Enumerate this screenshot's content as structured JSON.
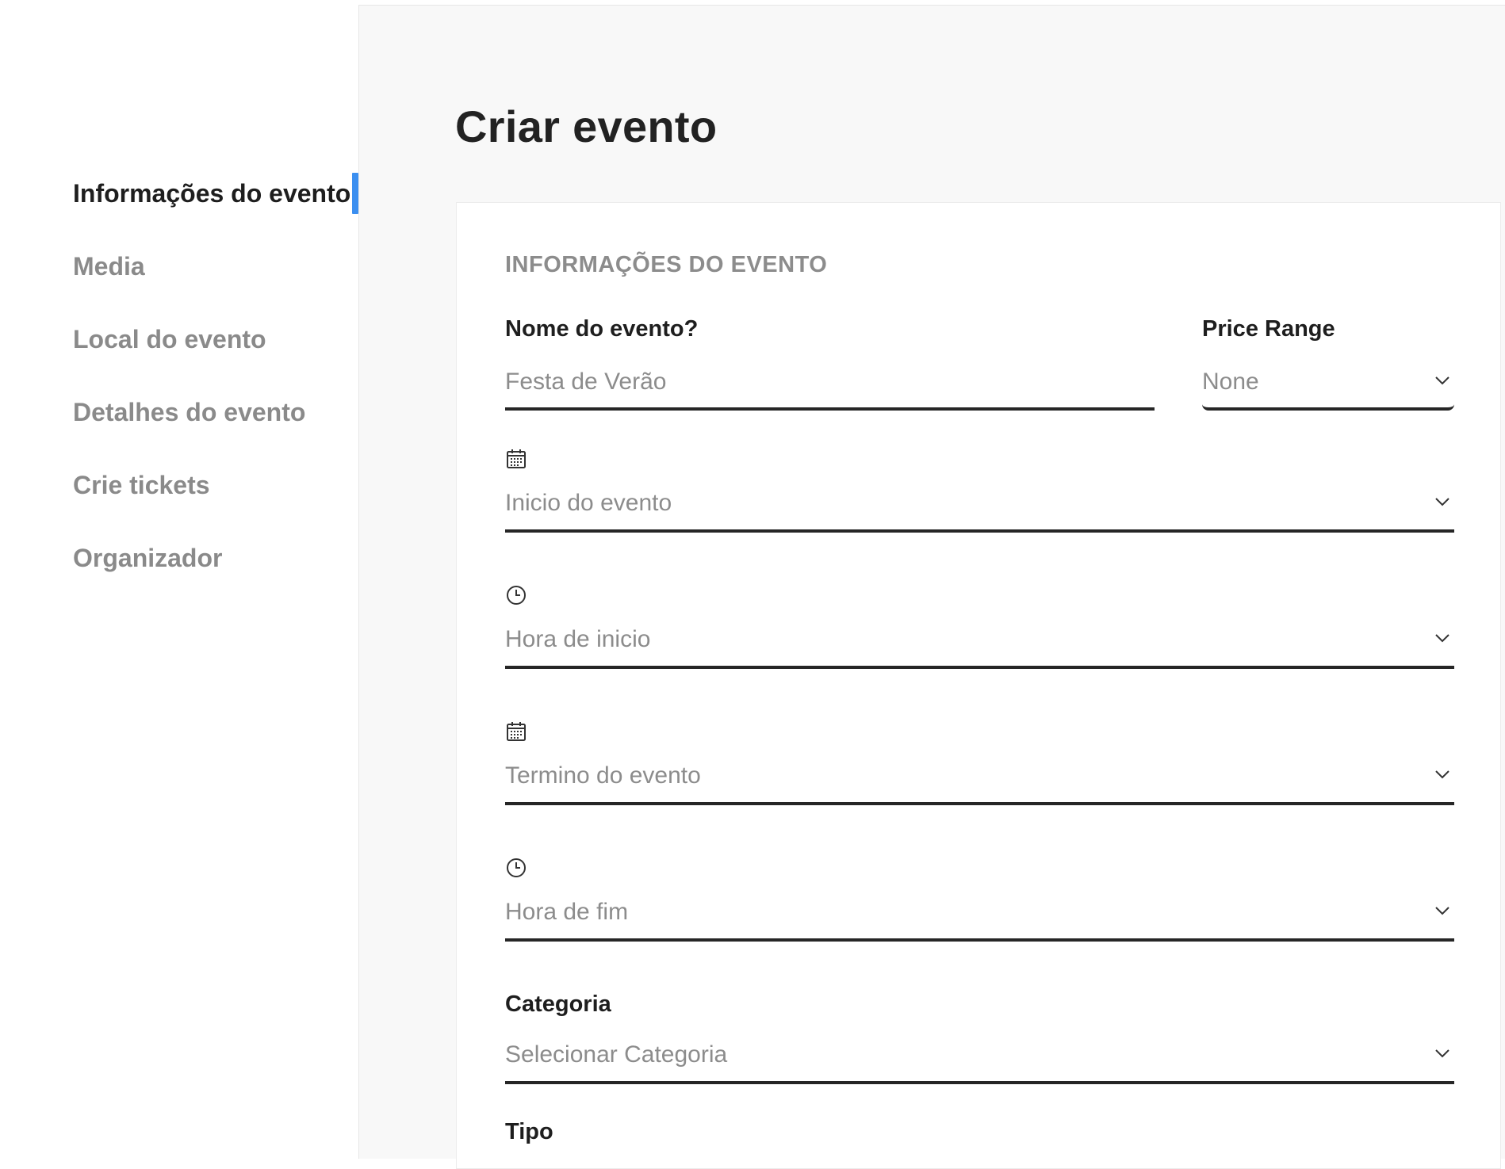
{
  "sidebar": {
    "items": [
      {
        "label": "Informações do evento",
        "active": true
      },
      {
        "label": "Media",
        "active": false
      },
      {
        "label": "Local do evento",
        "active": false
      },
      {
        "label": "Detalhes do evento",
        "active": false
      },
      {
        "label": "Crie tickets",
        "active": false
      },
      {
        "label": "Organizador",
        "active": false
      }
    ]
  },
  "main": {
    "title": "Criar evento",
    "section_title": "INFORMAÇÕES DO EVENTO",
    "form": {
      "event_name": {
        "label": "Nome do evento?",
        "placeholder": "Festa de Verão"
      },
      "price_range": {
        "label": "Price Range",
        "value": "None"
      },
      "start_date": {
        "placeholder": "Inicio do evento",
        "icon": "calendar-icon"
      },
      "start_time": {
        "placeholder": "Hora de inicio",
        "icon": "clock-icon"
      },
      "end_date": {
        "placeholder": "Termino do evento",
        "icon": "calendar-icon"
      },
      "end_time": {
        "placeholder": "Hora de fim",
        "icon": "clock-icon"
      },
      "category": {
        "label": "Categoria",
        "placeholder": "Selecionar Categoria"
      },
      "type": {
        "label": "Tipo"
      }
    }
  },
  "colors": {
    "accent": "#3b8ff0",
    "main_background": "#f8f8f8",
    "muted_text": "#8c8c8c",
    "field_border": "#262626"
  }
}
